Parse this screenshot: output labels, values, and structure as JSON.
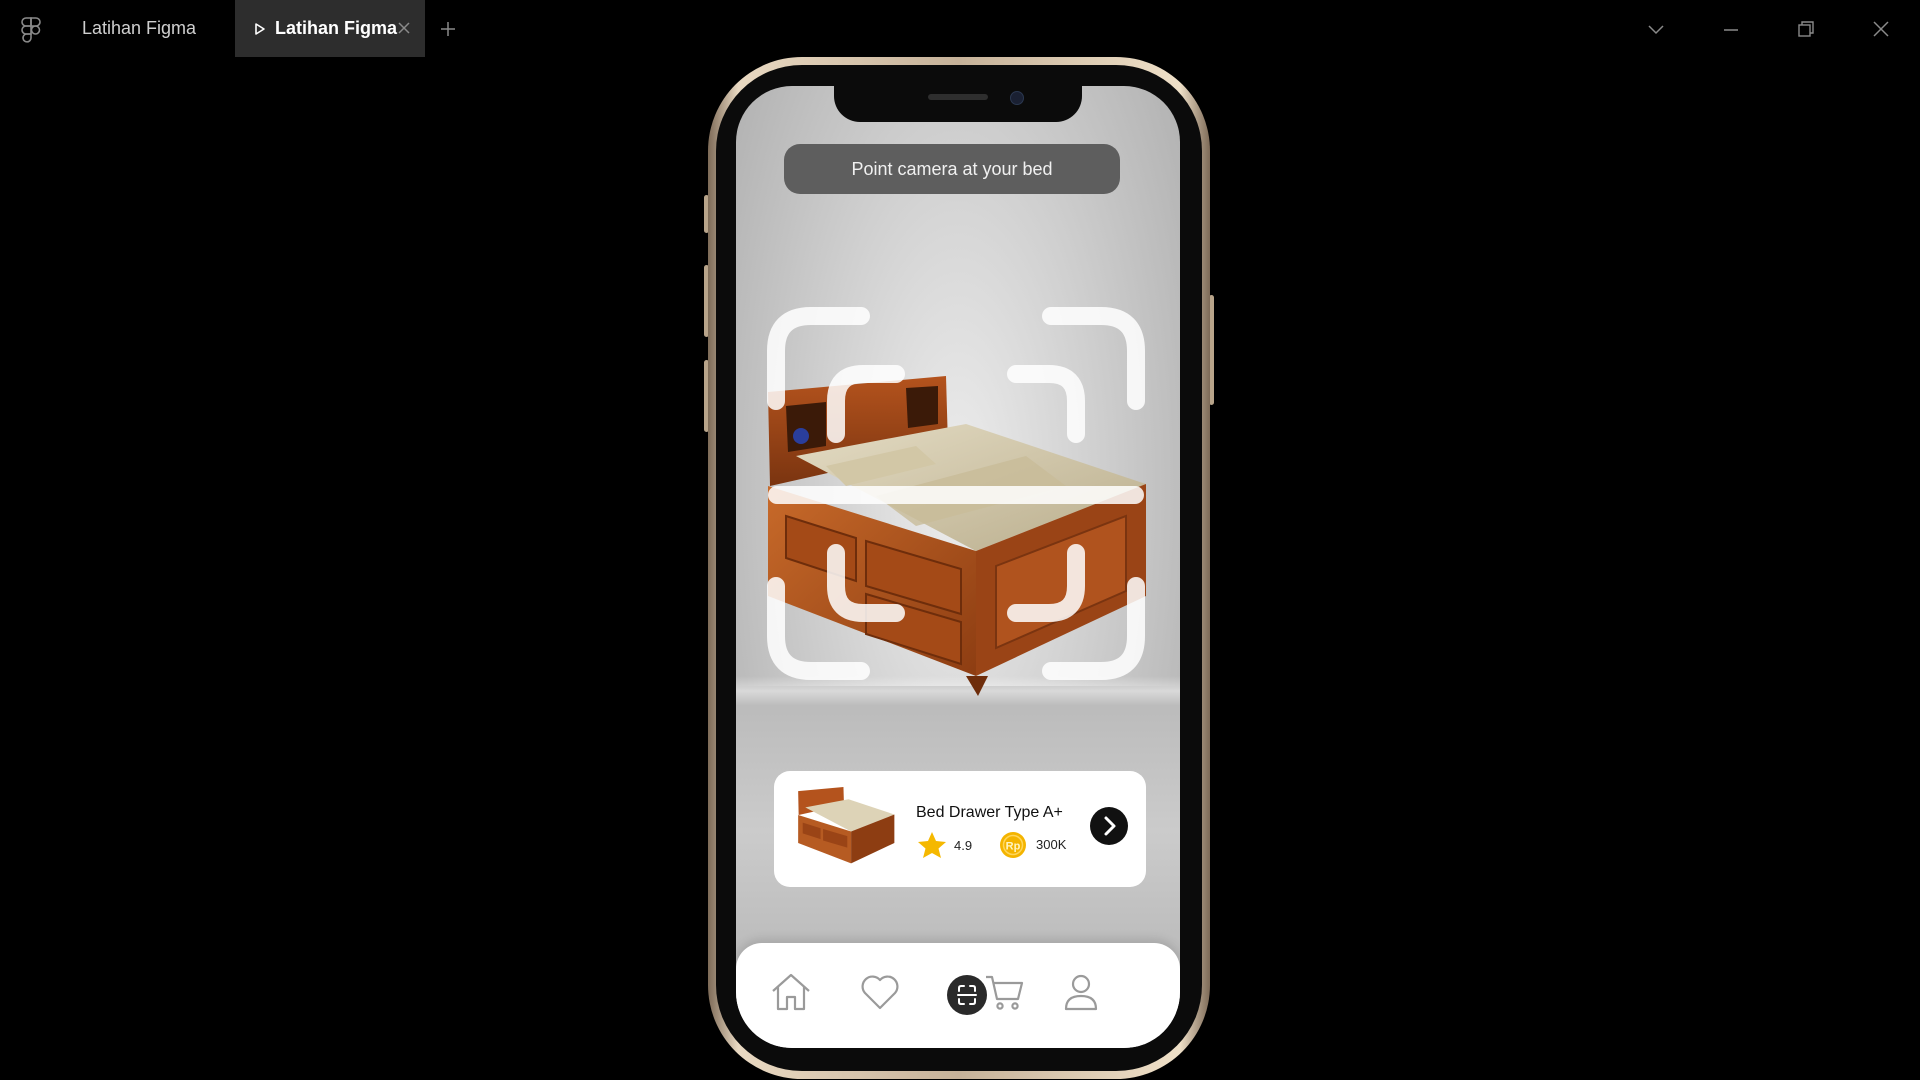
{
  "window": {
    "tabs": [
      {
        "label": "Latihan Figma",
        "active": false
      },
      {
        "label": "Latihan Figma",
        "active": true
      }
    ],
    "icons": [
      "figma-icon",
      "play-icon",
      "close-tab-icon",
      "plus-icon",
      "chevron-down-icon",
      "minimize-icon",
      "restore-icon",
      "close-icon"
    ]
  },
  "app": {
    "hint_text": "Point camera at your bed",
    "product": {
      "name": "Bed Drawer Type A+",
      "rating": "4.9",
      "price": "300K"
    },
    "nav": {
      "items": [
        "home-icon",
        "heart-icon",
        "scan-icon",
        "cart-icon",
        "profile-icon"
      ],
      "active": "scan-icon"
    },
    "colors": {
      "accent_dark": "#2a2a2a",
      "star": "#f5b800",
      "coin": "#f4b400",
      "wood": "#b4531d"
    }
  }
}
